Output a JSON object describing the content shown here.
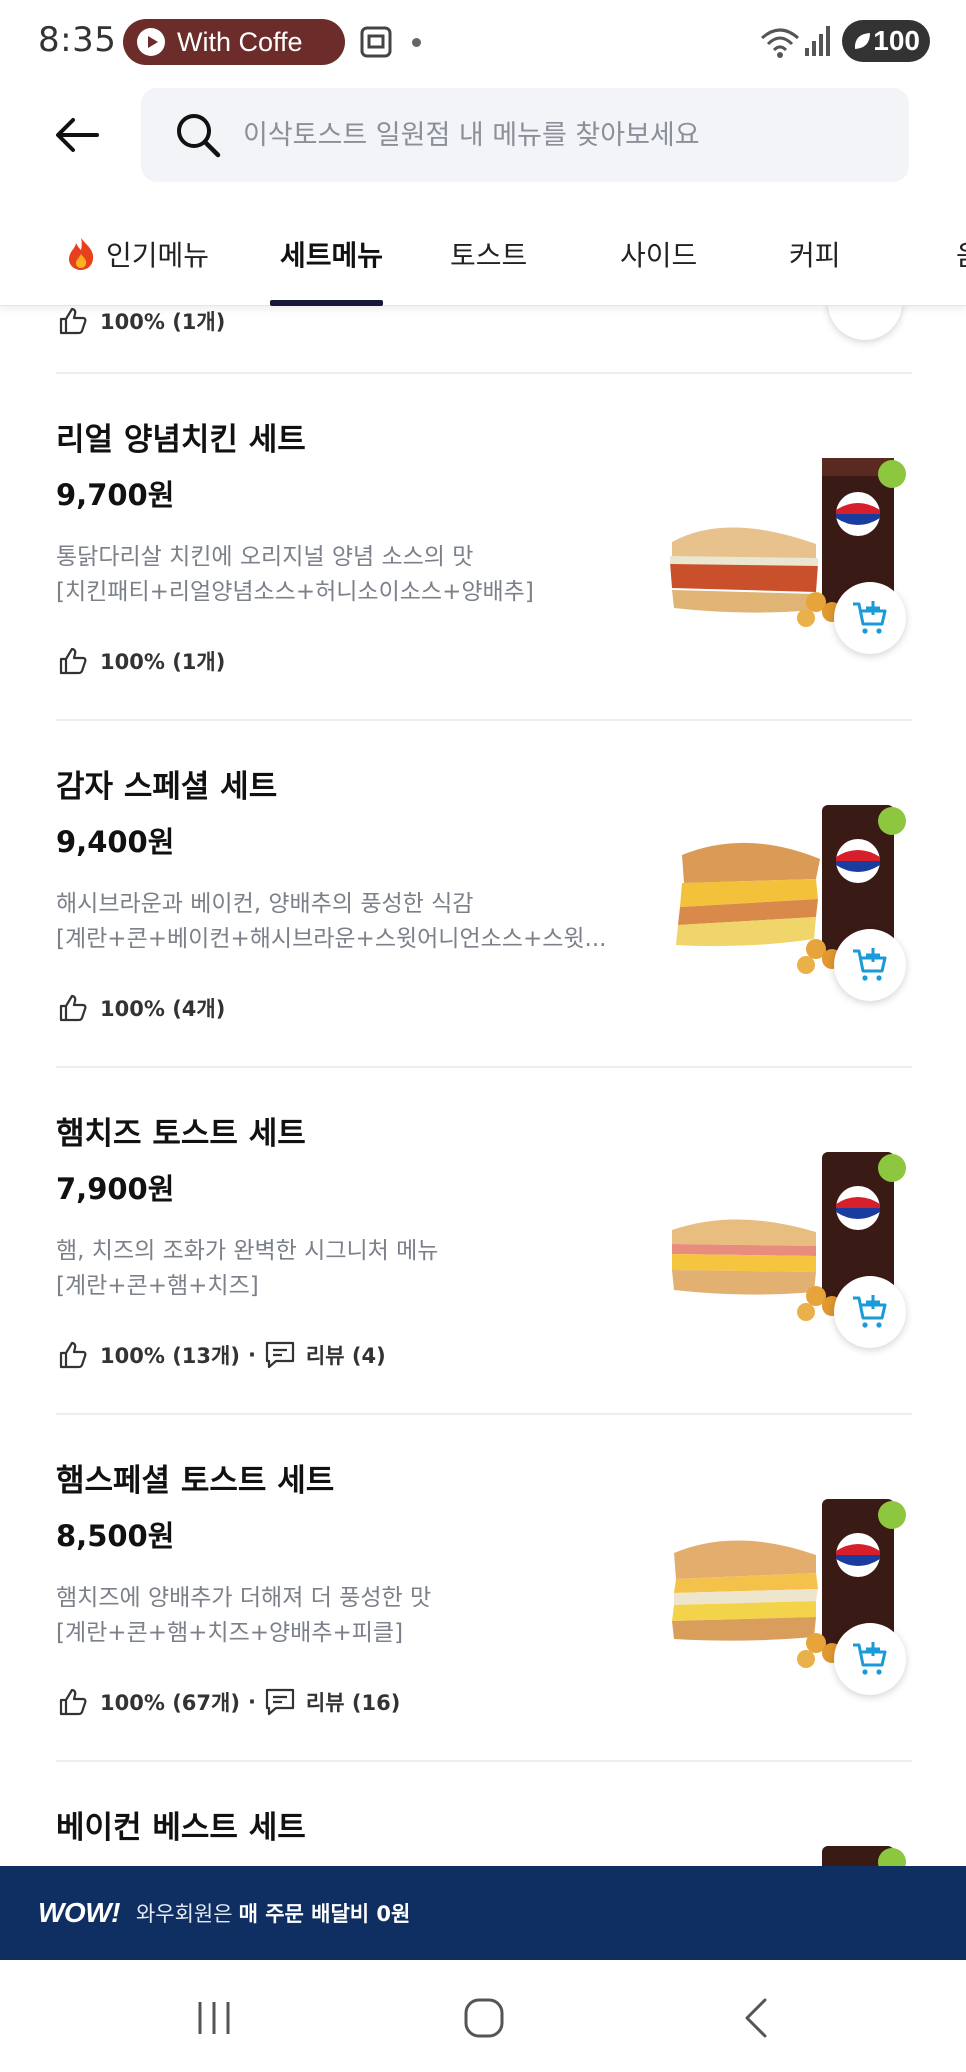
{
  "status_bar": {
    "time": "8:35",
    "media_label": "With Coffe",
    "battery": "100"
  },
  "search": {
    "placeholder": "이삭토스트 일원점 내 메뉴를 찾아보세요"
  },
  "tabs": [
    {
      "label": "인기메뉴"
    },
    {
      "label": "세트메뉴"
    },
    {
      "label": "토스트"
    },
    {
      "label": "사이드"
    },
    {
      "label": "커피"
    },
    {
      "label": "음"
    }
  ],
  "partial_item": {
    "rating": "100% (1개)"
  },
  "menu_items": [
    {
      "name": "리얼 양념치킨 세트",
      "price": "9,700원",
      "desc_line1": "통닭다리살 치킨에 오리지널 양념 소스의 맛",
      "desc_line2": "[치킨패티+리얼양념소스+허니소이소스+양배추]",
      "rating": "100% (1개)"
    },
    {
      "name": "감자 스페셜 세트",
      "price": "9,400원",
      "desc_line1": "해시브라운과 베이컨, 양배추의 풍성한 식감",
      "desc_line2": "[계란+콘+베이컨+해시브라운+스윗어니언소스+스윗...",
      "rating": "100% (4개)"
    },
    {
      "name": "햄치즈 토스트 세트",
      "price": "7,900원",
      "desc_line1": "햄, 치즈의 조화가 완벽한 시그니처 메뉴",
      "desc_line2": "[계란+콘+햄+치즈]",
      "rating": "100% (13개)",
      "reviews": "리뷰 (4)"
    },
    {
      "name": "햄스페셜 토스트 세트",
      "price": "8,500원",
      "desc_line1": "햄치즈에 양배추가 더해져 더 풍성한 맛",
      "desc_line2": "[계란+콘+햄+치즈+양배추+피클]",
      "rating": "100% (67개)",
      "reviews": "리뷰 (16)"
    },
    {
      "name": "베이컨 베스트 세트"
    }
  ],
  "banner": {
    "logo": "WOW!",
    "text1": "와우회원은",
    "text2": "매 주문 배달비 0원"
  },
  "colors": {
    "banner_bg": "#0f2f62",
    "cart_accent": "#1a9ad6",
    "tab_underline": "#17173a",
    "media_pill": "#6b2c2a"
  }
}
